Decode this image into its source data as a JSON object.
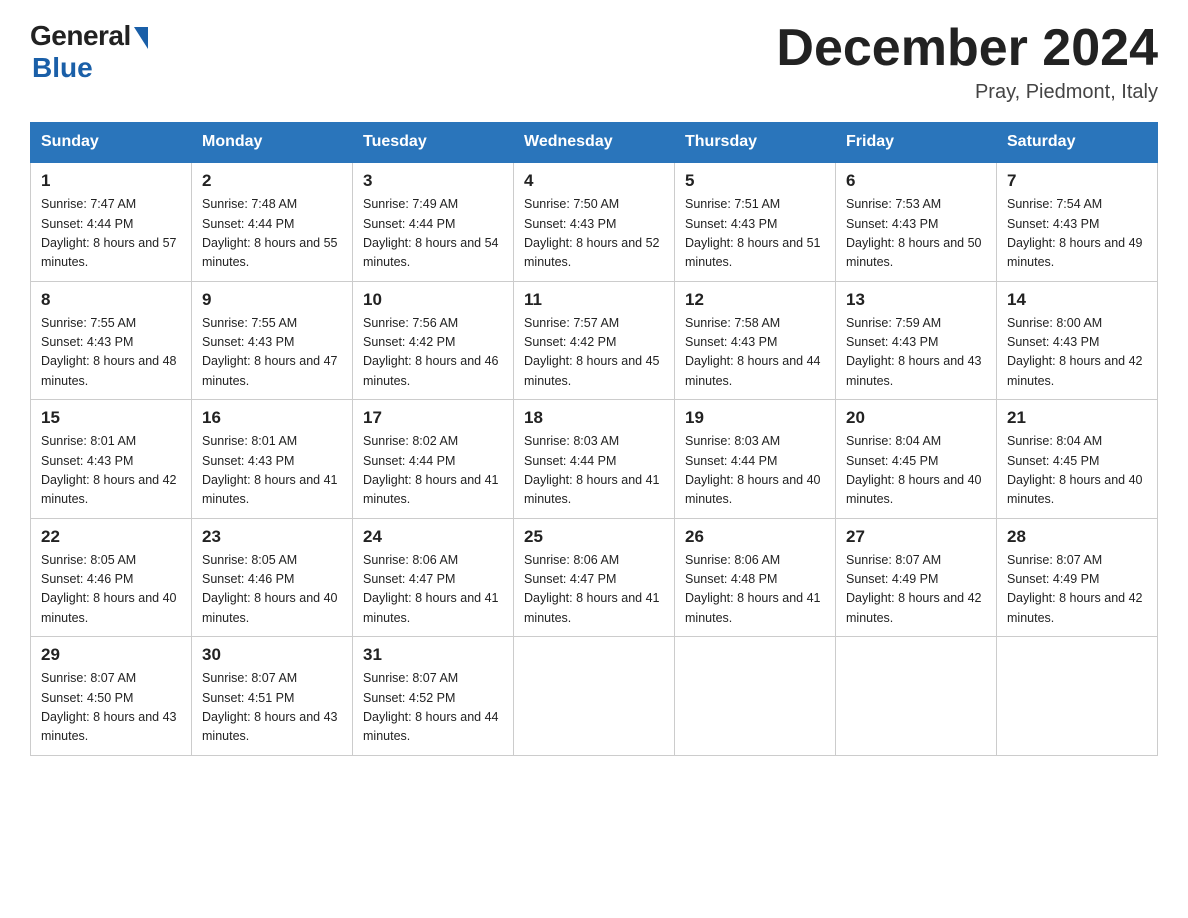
{
  "header": {
    "logo_general": "General",
    "logo_blue": "Blue",
    "title": "December 2024",
    "subtitle": "Pray, Piedmont, Italy"
  },
  "days_of_week": [
    "Sunday",
    "Monday",
    "Tuesday",
    "Wednesday",
    "Thursday",
    "Friday",
    "Saturday"
  ],
  "weeks": [
    [
      {
        "day": "1",
        "sunrise": "7:47 AM",
        "sunset": "4:44 PM",
        "daylight": "8 hours and 57 minutes."
      },
      {
        "day": "2",
        "sunrise": "7:48 AM",
        "sunset": "4:44 PM",
        "daylight": "8 hours and 55 minutes."
      },
      {
        "day": "3",
        "sunrise": "7:49 AM",
        "sunset": "4:44 PM",
        "daylight": "8 hours and 54 minutes."
      },
      {
        "day": "4",
        "sunrise": "7:50 AM",
        "sunset": "4:43 PM",
        "daylight": "8 hours and 52 minutes."
      },
      {
        "day": "5",
        "sunrise": "7:51 AM",
        "sunset": "4:43 PM",
        "daylight": "8 hours and 51 minutes."
      },
      {
        "day": "6",
        "sunrise": "7:53 AM",
        "sunset": "4:43 PM",
        "daylight": "8 hours and 50 minutes."
      },
      {
        "day": "7",
        "sunrise": "7:54 AM",
        "sunset": "4:43 PM",
        "daylight": "8 hours and 49 minutes."
      }
    ],
    [
      {
        "day": "8",
        "sunrise": "7:55 AM",
        "sunset": "4:43 PM",
        "daylight": "8 hours and 48 minutes."
      },
      {
        "day": "9",
        "sunrise": "7:55 AM",
        "sunset": "4:43 PM",
        "daylight": "8 hours and 47 minutes."
      },
      {
        "day": "10",
        "sunrise": "7:56 AM",
        "sunset": "4:42 PM",
        "daylight": "8 hours and 46 minutes."
      },
      {
        "day": "11",
        "sunrise": "7:57 AM",
        "sunset": "4:42 PM",
        "daylight": "8 hours and 45 minutes."
      },
      {
        "day": "12",
        "sunrise": "7:58 AM",
        "sunset": "4:43 PM",
        "daylight": "8 hours and 44 minutes."
      },
      {
        "day": "13",
        "sunrise": "7:59 AM",
        "sunset": "4:43 PM",
        "daylight": "8 hours and 43 minutes."
      },
      {
        "day": "14",
        "sunrise": "8:00 AM",
        "sunset": "4:43 PM",
        "daylight": "8 hours and 42 minutes."
      }
    ],
    [
      {
        "day": "15",
        "sunrise": "8:01 AM",
        "sunset": "4:43 PM",
        "daylight": "8 hours and 42 minutes."
      },
      {
        "day": "16",
        "sunrise": "8:01 AM",
        "sunset": "4:43 PM",
        "daylight": "8 hours and 41 minutes."
      },
      {
        "day": "17",
        "sunrise": "8:02 AM",
        "sunset": "4:44 PM",
        "daylight": "8 hours and 41 minutes."
      },
      {
        "day": "18",
        "sunrise": "8:03 AM",
        "sunset": "4:44 PM",
        "daylight": "8 hours and 41 minutes."
      },
      {
        "day": "19",
        "sunrise": "8:03 AM",
        "sunset": "4:44 PM",
        "daylight": "8 hours and 40 minutes."
      },
      {
        "day": "20",
        "sunrise": "8:04 AM",
        "sunset": "4:45 PM",
        "daylight": "8 hours and 40 minutes."
      },
      {
        "day": "21",
        "sunrise": "8:04 AM",
        "sunset": "4:45 PM",
        "daylight": "8 hours and 40 minutes."
      }
    ],
    [
      {
        "day": "22",
        "sunrise": "8:05 AM",
        "sunset": "4:46 PM",
        "daylight": "8 hours and 40 minutes."
      },
      {
        "day": "23",
        "sunrise": "8:05 AM",
        "sunset": "4:46 PM",
        "daylight": "8 hours and 40 minutes."
      },
      {
        "day": "24",
        "sunrise": "8:06 AM",
        "sunset": "4:47 PM",
        "daylight": "8 hours and 41 minutes."
      },
      {
        "day": "25",
        "sunrise": "8:06 AM",
        "sunset": "4:47 PM",
        "daylight": "8 hours and 41 minutes."
      },
      {
        "day": "26",
        "sunrise": "8:06 AM",
        "sunset": "4:48 PM",
        "daylight": "8 hours and 41 minutes."
      },
      {
        "day": "27",
        "sunrise": "8:07 AM",
        "sunset": "4:49 PM",
        "daylight": "8 hours and 42 minutes."
      },
      {
        "day": "28",
        "sunrise": "8:07 AM",
        "sunset": "4:49 PM",
        "daylight": "8 hours and 42 minutes."
      }
    ],
    [
      {
        "day": "29",
        "sunrise": "8:07 AM",
        "sunset": "4:50 PM",
        "daylight": "8 hours and 43 minutes."
      },
      {
        "day": "30",
        "sunrise": "8:07 AM",
        "sunset": "4:51 PM",
        "daylight": "8 hours and 43 minutes."
      },
      {
        "day": "31",
        "sunrise": "8:07 AM",
        "sunset": "4:52 PM",
        "daylight": "8 hours and 44 minutes."
      },
      null,
      null,
      null,
      null
    ]
  ]
}
